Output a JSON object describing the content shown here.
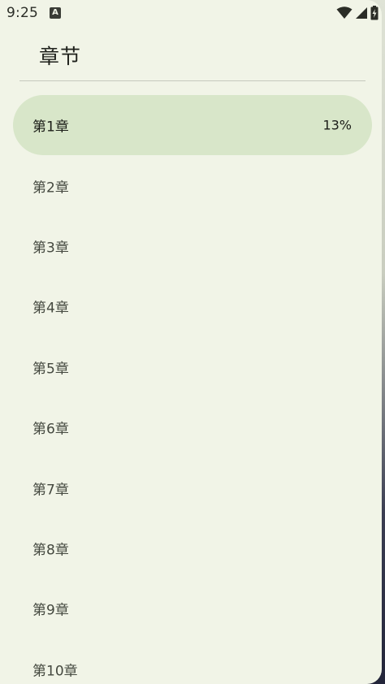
{
  "status_bar": {
    "time": "9:25",
    "notification_icon": "A",
    "icons": [
      "wifi-icon",
      "cellular-signal-icon",
      "battery-charging-icon"
    ]
  },
  "drawer": {
    "title": "章节",
    "chapters": [
      {
        "label": "第1章",
        "progress": "13%",
        "active": true
      },
      {
        "label": "第2章"
      },
      {
        "label": "第3章"
      },
      {
        "label": "第4章"
      },
      {
        "label": "第5章"
      },
      {
        "label": "第6章"
      },
      {
        "label": "第7章"
      },
      {
        "label": "第8章"
      },
      {
        "label": "第9章"
      },
      {
        "label": "第10章"
      }
    ]
  },
  "colors": {
    "drawer_background": "#f1f4e7",
    "active_item_background": "#d8e6c9",
    "text_primary": "#1b1d18",
    "text_secondary": "#44483f",
    "divider": "#c6c9bd"
  }
}
